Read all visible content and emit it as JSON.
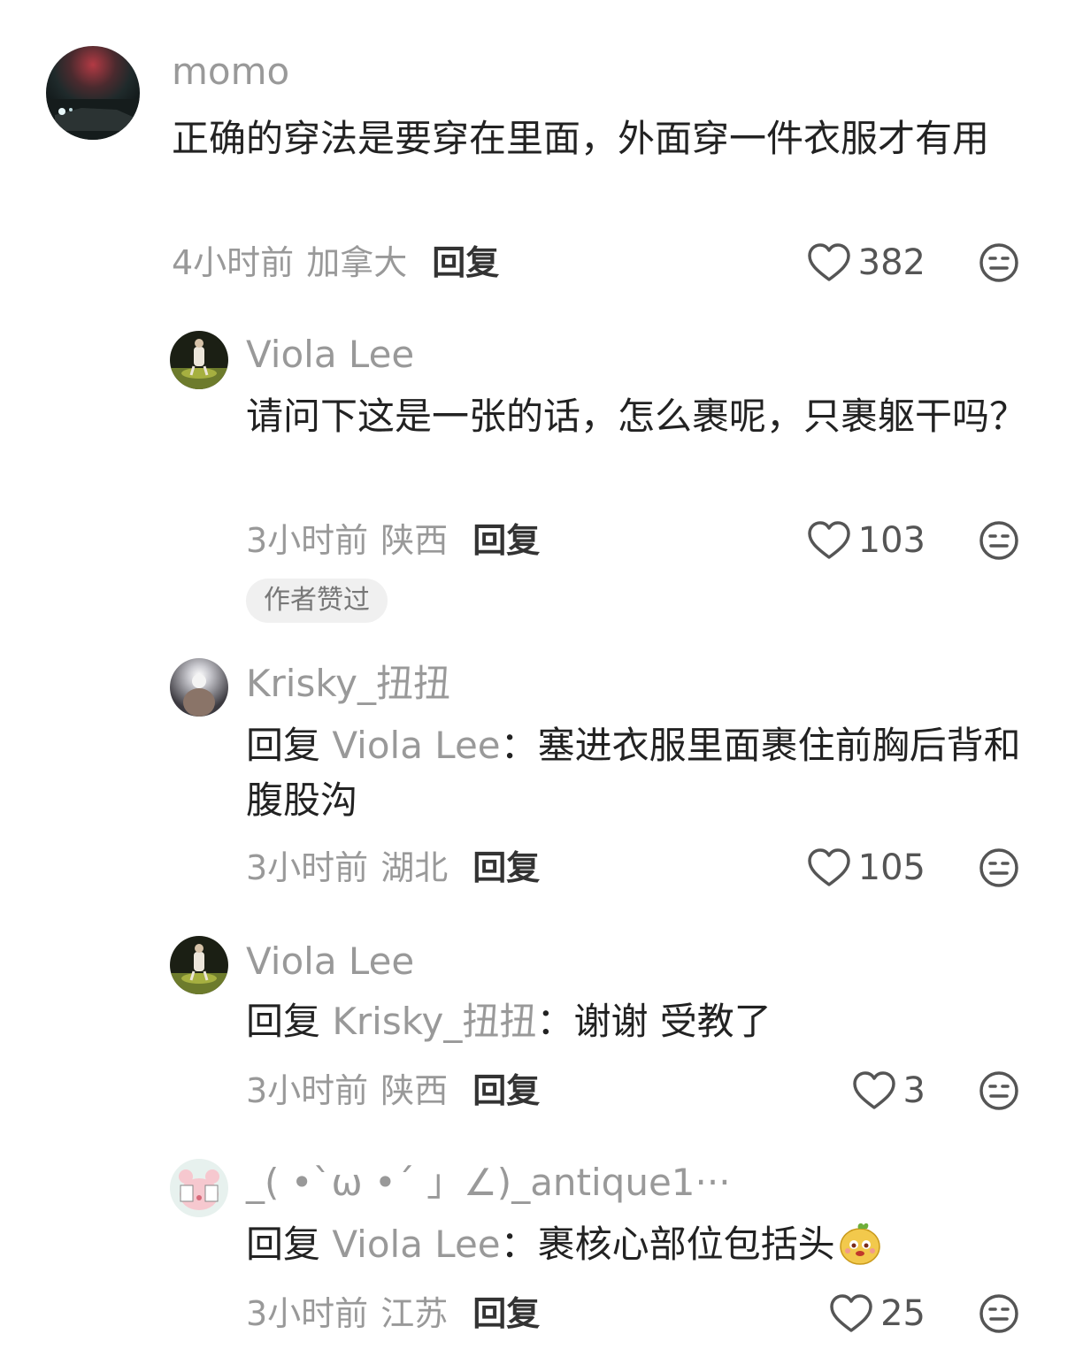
{
  "comments": [
    {
      "username": "momo",
      "content": "正确的穿法是要穿在里面，外面穿一件衣服才有用",
      "time": "4小时前",
      "location": "加拿大",
      "reply_label": "回复",
      "likes": "382"
    },
    {
      "username": "Viola Lee",
      "content": "请问下这是一张的话，怎么裹呢，只裹躯干吗？",
      "time": "3小时前",
      "location": "陕西",
      "reply_label": "回复",
      "likes": "103",
      "badge": "作者赞过"
    },
    {
      "username": "Krisky_扭扭",
      "reply_prefix": "回复",
      "reply_target": "Viola Lee",
      "reply_sep": "：",
      "content": "塞进衣服里面裹住前胸后背和腹股沟",
      "time": "3小时前",
      "location": "湖北",
      "reply_label": "回复",
      "likes": "105"
    },
    {
      "username": "Viola Lee",
      "reply_prefix": "回复",
      "reply_target": "Krisky_扭扭",
      "reply_sep": "：",
      "content": "谢谢 受教了",
      "time": "3小时前",
      "location": "陕西",
      "reply_label": "回复",
      "likes": "3"
    },
    {
      "username": "_( •`ω •´ 」∠)_antique1···",
      "reply_prefix": "回复",
      "reply_target": "Viola Lee",
      "reply_sep": "：",
      "content": "裹核心部位包括头",
      "time": "3小时前",
      "location": "江苏",
      "reply_label": "回复",
      "likes": "25"
    }
  ],
  "icons": {
    "like": "heart-outline-icon",
    "dislike": "meh-face-icon",
    "emoji": "yellow-bean-emoji"
  },
  "colors": {
    "text": "#222222",
    "muted": "#999999",
    "badge_bg": "#f0f0f0"
  }
}
